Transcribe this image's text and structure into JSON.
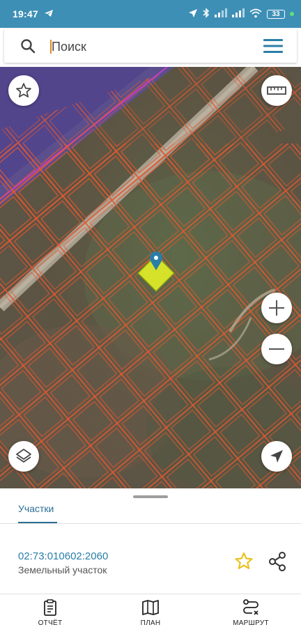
{
  "status_bar": {
    "time": "19:47",
    "battery": "33",
    "icons": [
      "telegram-icon",
      "location-arrow-icon",
      "bluetooth-icon",
      "signal-icon",
      "signal-icon",
      "wifi-icon",
      "battery-icon"
    ]
  },
  "search": {
    "placeholder": "Поиск",
    "value": ""
  },
  "map": {
    "favorite_button": "star-icon",
    "ruler_button": "ruler-icon",
    "zoom_in": "plus-icon",
    "zoom_out": "minus-icon",
    "layers_button": "layers-icon",
    "locate_button": "navigation-arrow-icon",
    "colors": {
      "parcel_border": "#e4572e",
      "selected_parcel": "#d6e22a",
      "marker": "#2a7ea8"
    }
  },
  "panel": {
    "tab_label": "Участки",
    "parcel_id": "02:73:010602:2060",
    "parcel_type": "Земельный участок"
  },
  "bottom_nav": [
    {
      "label": "ОТЧЁТ",
      "icon": "clipboard-icon"
    },
    {
      "label": "ПЛАН",
      "icon": "map-icon"
    },
    {
      "label": "МАРШРУТ",
      "icon": "route-icon"
    }
  ],
  "colors": {
    "status_bar": "#3d8fb6",
    "accent": "#2a7ea8",
    "star": "#e8c21e"
  }
}
